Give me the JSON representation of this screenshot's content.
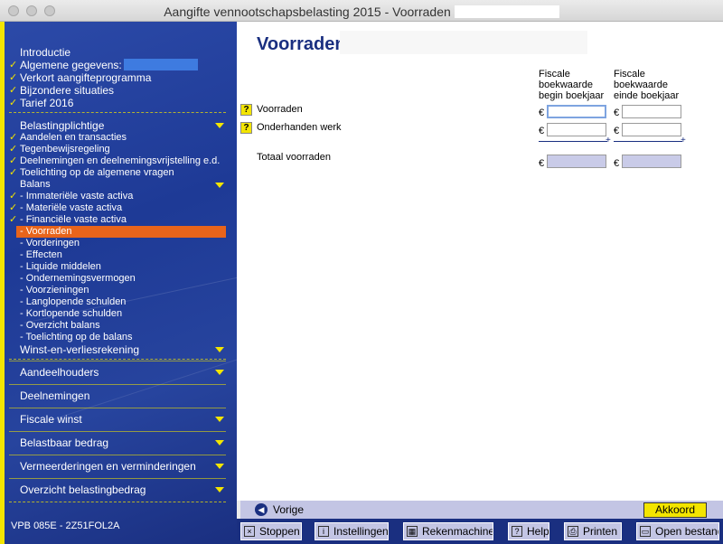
{
  "window": {
    "title": "Aangifte vennootschapsbelasting 2015 - Voorraden"
  },
  "sidebar": {
    "top_items": [
      {
        "label": "Introductie",
        "checked": false
      },
      {
        "label": "Algemene gegevens:",
        "checked": true
      },
      {
        "label": "Verkort aangifteprogramma",
        "checked": true
      },
      {
        "label": "Bijzondere situaties",
        "checked": true
      },
      {
        "label": "Tarief 2016",
        "checked": true
      }
    ],
    "group_title": "Belastingplichtige",
    "group_items": [
      {
        "label": "Aandelen en transacties",
        "checked": true
      },
      {
        "label": "Tegenbewijsregeling",
        "checked": true
      },
      {
        "label": "Deelnemingen en deelnemingsvrijstelling e.d.",
        "checked": true
      },
      {
        "label": "Toelichting op de algemene vragen",
        "checked": true
      }
    ],
    "balans_title": "Balans",
    "balans_items": [
      {
        "label": "- Immateriële vaste activa",
        "checked": true
      },
      {
        "label": "- Materiële vaste activa",
        "checked": true
      },
      {
        "label": "- Financiële vaste activa",
        "checked": true
      },
      {
        "label": "- Voorraden",
        "checked": false,
        "selected": true
      },
      {
        "label": "- Vorderingen",
        "checked": false
      },
      {
        "label": "- Effecten",
        "checked": false
      },
      {
        "label": "- Liquide middelen",
        "checked": false
      },
      {
        "label": "- Ondernemingsvermogen",
        "checked": false
      },
      {
        "label": "- Voorzieningen",
        "checked": false
      },
      {
        "label": "- Langlopende schulden",
        "checked": false
      },
      {
        "label": "- Kortlopende schulden",
        "checked": false
      },
      {
        "label": "- Overzicht balans",
        "checked": false
      },
      {
        "label": "- Toelichting op de balans",
        "checked": false
      }
    ],
    "winst_title": "Winst-en-verliesrekening",
    "sections": [
      {
        "label": "Aandeelhouders",
        "has_arrow": true
      },
      {
        "label": "Deelnemingen",
        "has_arrow": false
      },
      {
        "label": "Fiscale winst",
        "has_arrow": true
      },
      {
        "label": "Belastbaar bedrag",
        "has_arrow": true
      },
      {
        "label": "Vermeerderingen en verminderingen",
        "has_arrow": true
      },
      {
        "label": "Overzicht belastingbedrag",
        "has_arrow": true
      }
    ],
    "footer_code": "VPB 085E - 2Z51FOL2A"
  },
  "main": {
    "page_title": "Voorraden",
    "col_begin": "Fiscale boekwaarde begin boekjaar",
    "col_end": "Fiscale boekwaarde einde boekjaar",
    "row_voorraden": "Voorraden",
    "row_onderhanden": "Onderhanden werk",
    "row_totaal": "Totaal voorraden",
    "currency": "€",
    "help_glyph": "?",
    "plus_glyph": "+",
    "values": {
      "voorraden_begin": "",
      "voorraden_einde": "",
      "onderhanden_begin": "",
      "onderhanden_einde": "",
      "totaal_begin": "",
      "totaal_einde": ""
    }
  },
  "navigation": {
    "vorige": "Vorige",
    "akkoord": "Akkoord"
  },
  "toolbar": {
    "stoppen": "Stoppen",
    "instellingen": "Instellingen",
    "rekenmachine": "Rekenmachine",
    "help": "Help",
    "printen": "Printen",
    "open_bestand": "Open bestand"
  },
  "colors": {
    "sidebar_blue": "#1e3a96",
    "accent_yellow": "#f3e500",
    "selected_orange": "#e8641b",
    "title_blue": "#1a2f80",
    "field_total": "#c9cbe8"
  }
}
